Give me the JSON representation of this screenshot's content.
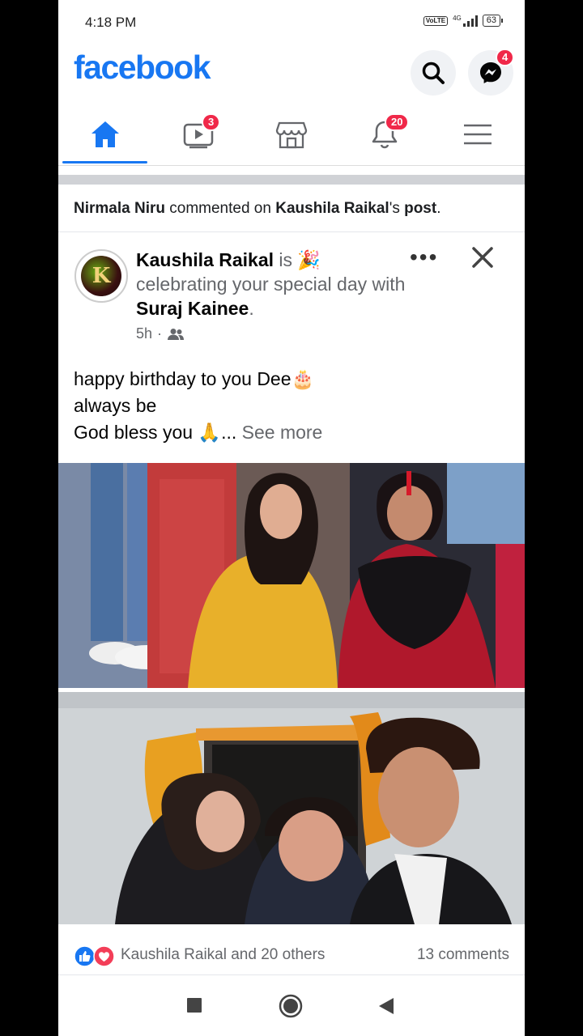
{
  "status_bar": {
    "time": "4:18 PM",
    "network": "4G",
    "volte": "Vo LTE",
    "battery": "63"
  },
  "header": {
    "logo": "facebook",
    "messenger_badge": "4"
  },
  "tabs": [
    {
      "name": "home",
      "badge": ""
    },
    {
      "name": "watch",
      "badge": "3"
    },
    {
      "name": "marketplace",
      "badge": ""
    },
    {
      "name": "notifications",
      "badge": "20"
    },
    {
      "name": "menu",
      "badge": ""
    }
  ],
  "notification": {
    "actor": "Nirmala Niru",
    "action": " commented on ",
    "owner": "Kaushila Raikal",
    "suffix": "'s ",
    "object": "post",
    "end": "."
  },
  "post": {
    "author": "Kaushila Raikal",
    "is_word": " is ",
    "activity": "celebrating your special day with ",
    "tagged": "Suraj Kainee",
    "period": ".",
    "time": "5h",
    "separator": "·",
    "text_line1": "happy birthday to you Dee",
    "text_line2": "always be",
    "text_line3": "God bless you ",
    "ellipsis": "... ",
    "see_more": "See more",
    "reactions_label": "Kaushila Raikal and 20 others",
    "comments_label": "13 comments"
  },
  "colors": {
    "brand": "#1877f2",
    "badge": "#f02849"
  }
}
